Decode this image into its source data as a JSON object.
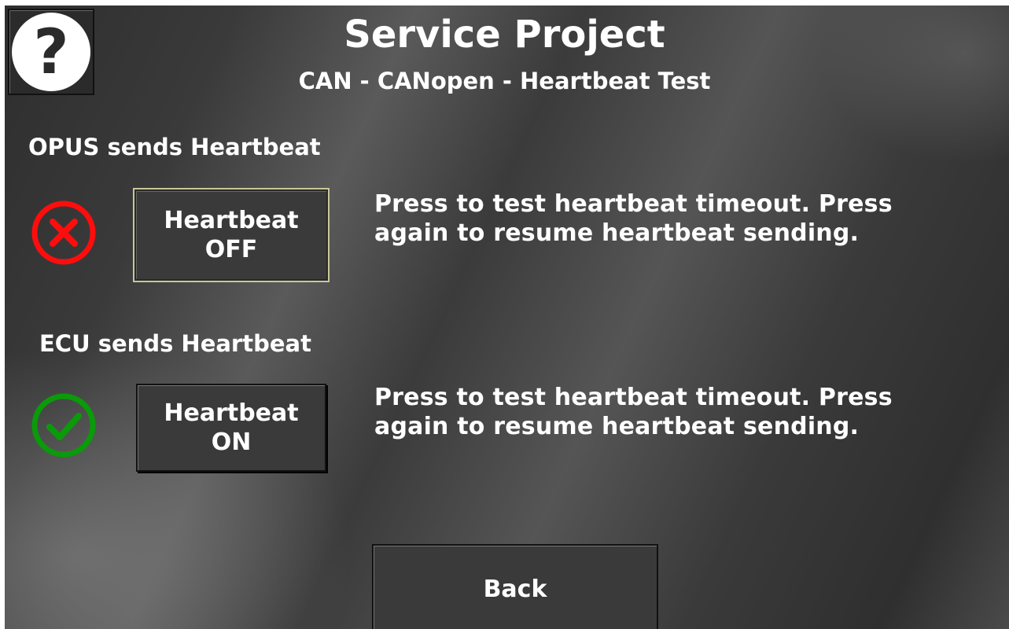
{
  "header": {
    "title": "Service Project",
    "subtitle": "CAN - CANopen - Heartbeat Test",
    "help_glyph": "?"
  },
  "opus_section": {
    "label": "OPUS sends Heartbeat",
    "status": "error",
    "status_icon": "cross-circle-icon",
    "status_color": "#ff0d0d",
    "button_line1": "Heartbeat",
    "button_line2": "OFF",
    "description": "Press to test heartbeat timeout. Press again to resume heartbeat sending."
  },
  "ecu_section": {
    "label": "ECU sends Heartbeat",
    "status": "ok",
    "status_icon": "check-circle-icon",
    "status_color": "#0a9a0a",
    "button_line1": "Heartbeat",
    "button_line2": "ON",
    "description": "Press to test heartbeat timeout. Press again to resume heartbeat sending."
  },
  "footer": {
    "back_label": "Back"
  }
}
